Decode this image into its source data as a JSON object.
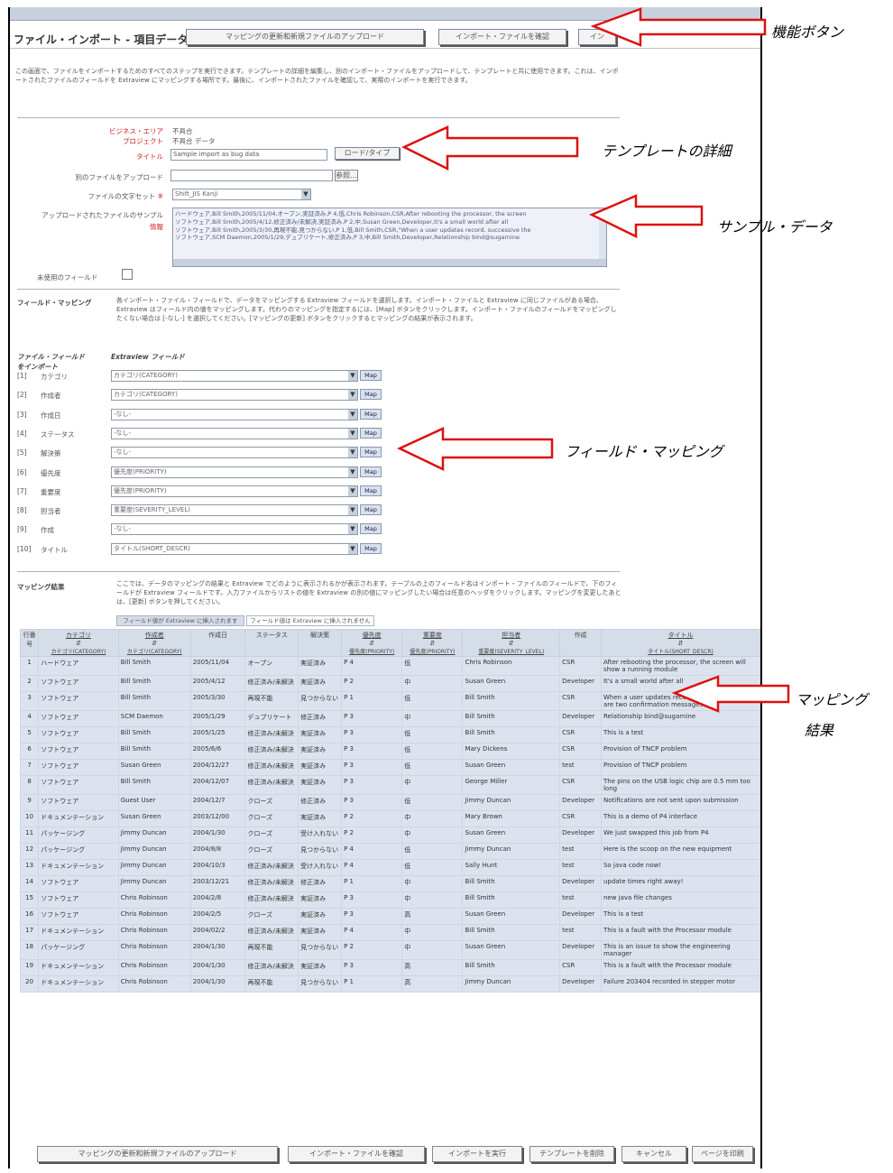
{
  "page": {
    "title": "ファイル・インポート - 項目データ",
    "intro": "この画面で、ファイルをインポートするためのすべてのステップを実行できます。テンプレートの詳細を編集し、別のインポート・ファイルをアップロードして、テンプレートと共に使用できます。これは、インポートされたファイルのフィールドを Extraview にマッピングする場所です。最後に、インポートされたファイルを確認して、実際のインポートを実行できます。"
  },
  "top_buttons": [
    "マッピングの更新和新規ファイルのアップロード",
    "インポート・ファイルを確認",
    "イン"
  ],
  "details": {
    "bizarea_label": "ビジネス・エリア",
    "bizarea_value": "不具合",
    "project_label": "プロジェクト",
    "project_value": "不具合 データ",
    "title_label": "タイトル",
    "title_value": "Sample import as bug data",
    "title_button": "ロード/タイプ",
    "upload_label": "別のファイルをアップロード",
    "upload_button": "参照...",
    "charset_label": "ファイルの文字セット",
    "charset_value": "Shift_JIS Kanji",
    "sample_label": "アップロードされたファイルのサンプル",
    "sample_sub": "情報",
    "sample_lines": [
      "ハードウェア,Bill Smith,2005/11/04,オープン,実証済み,P 4,低,Chris Robinson,CSR,After rebooting the processor, the screen",
      "ソフトウェア,Bill Smith,2005/4/12,修正済み/未解決,実証済み,P 2,中,Susan Green,Developer,It's a small world after all",
      "ソフトウェア,Bill Smith,2005/3/30,再現不能,見つからない,P 1,低,Bill Smith,CSR,\"When a user updates record, successive the",
      "ソフトウェア,SCM Daemon,2005/1/29,デュプリケート,修正済み,P 3,中,Bill Smith,Developer,Relationship bind@sugarnine"
    ],
    "unused_label": "未使用のフィールド"
  },
  "field_mapping": {
    "label": "フィールド・マッピング",
    "desc": "各インポート・ファイル・フィールドで、データをマッピングする Extraview フィールドを選択します。インポート・ファイルと Extraview に同じファイルがある場合、Extraview はフィールド内の値をマッピングします。代わりのマッピングを指定するには、[Map] ボタンをクリックします。インポート・ファイルのフィールドをマッピングしたくない場合は [-なし-] を選択してください。[マッピングの更新] ボタンをクリックするとマッピングの結果が表示されます。",
    "col_import": "ファイル・フィールドをインポート",
    "col_ev": "Extraview フィールド",
    "map_label": "Map",
    "rows": [
      {
        "no": "[1]",
        "name": "カテゴリ",
        "ev": "カテゴリ(CATEGORY)"
      },
      {
        "no": "[2]",
        "name": "作成者",
        "ev": "カテゴリ(CATEGORY)"
      },
      {
        "no": "[3]",
        "name": "作成日",
        "ev": "-なし-"
      },
      {
        "no": "[4]",
        "name": "ステータス",
        "ev": "-なし-"
      },
      {
        "no": "[5]",
        "name": "解決策",
        "ev": "-なし-"
      },
      {
        "no": "[6]",
        "name": "優先度",
        "ev": "優先度(PRIORITY)"
      },
      {
        "no": "[7]",
        "name": "重要度",
        "ev": "優先度(PRIORITY)"
      },
      {
        "no": "[8]",
        "name": "担当者",
        "ev": "重要度(SEVERITY_LEVEL)"
      },
      {
        "no": "[9]",
        "name": "作成",
        "ev": "-なし-"
      },
      {
        "no": "[10]",
        "name": "タイトル",
        "ev": "タイトル(SHORT_DESCR)"
      }
    ]
  },
  "mapping_results": {
    "label": "マッピング結果",
    "desc": "ここでは、データのマッピングの結果と Extraview でどのように表示されるかが表示されます。テーブルの上のフィールド名はインポート・ファイルのフィールドで、下のフィールドが Extraview フィールドです。入力ファイルからリストの値を Extraview の別の値にマッピングしたい場合は任意のヘッダをクリックします。マッピングを変更したあとは、[更新] ボタンを押してください。",
    "legend_a": "フィールド値が Extraview に挿入されます",
    "legend_b": "フィールド値は Extraview に挿入されません",
    "headers": [
      {
        "top": "行番号",
        "bottom": ""
      },
      {
        "top": "カテゴリ",
        "bottom": "カテゴリ(CATEGORY)"
      },
      {
        "top": "作成者",
        "bottom": "カテゴリ(CATEGORY)"
      },
      {
        "top": "作成日",
        "bottom": ""
      },
      {
        "top": "ステータス",
        "bottom": ""
      },
      {
        "top": "解決策",
        "bottom": ""
      },
      {
        "top": "優先度",
        "bottom": "優先度(PRIORITY)"
      },
      {
        "top": "重要度",
        "bottom": "優先度(PRIORITY)"
      },
      {
        "top": "担当者",
        "bottom": "重要度(SEVERITY_LEVEL)"
      },
      {
        "top": "作成",
        "bottom": ""
      },
      {
        "top": "タイトル",
        "bottom": "タイトル(SHORT_DESCR)"
      }
    ],
    "rows": [
      [
        "1",
        "ハードウェア",
        "Bill Smith",
        "2005/11/04",
        "オープン",
        "実証済み",
        "P 4",
        "低",
        "Chris Robinson",
        "CSR",
        "After rebooting the processor, the screen will show a running module"
      ],
      [
        "2",
        "ソフトウェア",
        "Bill Smith",
        "2005/4/12",
        "修正済み/未解決",
        "実証済み",
        "P 2",
        "中",
        "Susan Green",
        "Developer",
        "It's a small world after all"
      ],
      [
        "3",
        "ソフトウェア",
        "Bill Smith",
        "2005/3/30",
        "再現不能",
        "見つからない",
        "P 1",
        "低",
        "Bill Smith",
        "CSR",
        "When a user updates record, successive there are two confirmation messages"
      ],
      [
        "4",
        "ソフトウェア",
        "SCM Daemon",
        "2005/1/29",
        "デュプリケート",
        "修正済み",
        "P 3",
        "中",
        "Bill Smith",
        "Developer",
        "Relationship bind@sugarnine"
      ],
      [
        "5",
        "ソフトウェア",
        "Bill Smith",
        "2005/1/25",
        "修正済み/未解決",
        "実証済み",
        "P 3",
        "低",
        "Bill Smith",
        "CSR",
        "This is a test"
      ],
      [
        "6",
        "ソフトウェア",
        "Bill Smith",
        "2005/6/6",
        "修正済み/未解決",
        "実証済み",
        "P 3",
        "低",
        "Mary Dickens",
        "CSR",
        "Provision of TNCP problem"
      ],
      [
        "7",
        "ソフトウェア",
        "Susan Green",
        "2004/12/27",
        "修正済み/未解決",
        "実証済み",
        "P 3",
        "低",
        "Susan Green",
        "test",
        "Provision of TNCP problem"
      ],
      [
        "8",
        "ソフトウェア",
        "Bill Smith",
        "2004/12/07",
        "修正済み/未解決",
        "実証済み",
        "P 3",
        "中",
        "George Miller",
        "CSR",
        "The pins on the USB logic chip are 0.5 mm too long"
      ],
      [
        "9",
        "ソフトウェア",
        "Guest User",
        "2004/12/7",
        "クローズ",
        "修正済み",
        "P 3",
        "低",
        "Jimmy Duncan",
        "Developer",
        "Notifications are not sent upon submission"
      ],
      [
        "10",
        "ドキュメンテーション",
        "Susan Green",
        "2003/12/00",
        "クローズ",
        "実証済み",
        "P 2",
        "中",
        "Mary Brown",
        "CSR",
        "This is a demo of P4 interface"
      ],
      [
        "11",
        "パッケージング",
        "Jimmy Duncan",
        "2004/1/30",
        "クローズ",
        "受け入れない",
        "P 2",
        "中",
        "Susan Green",
        "Developer",
        "We just swapped this job from P4"
      ],
      [
        "12",
        "パッケージング",
        "Jimmy Duncan",
        "2004/8/8",
        "クローズ",
        "見つからない",
        "P 4",
        "低",
        "Jimmy Duncan",
        "test",
        "Here is the scoop on the new equipment"
      ],
      [
        "13",
        "ドキュメンテーション",
        "Jimmy Duncan",
        "2004/10/3",
        "修正済み/未解決",
        "受け入れない",
        "P 4",
        "低",
        "Sally Hunt",
        "test",
        "So java code now!"
      ],
      [
        "14",
        "ソフトウェア",
        "Jimmy Duncan",
        "2003/12/21",
        "修正済み/未解決",
        "修正済み",
        "P 1",
        "中",
        "Bill Smith",
        "Developer",
        "update times right away!"
      ],
      [
        "15",
        "ソフトウェア",
        "Chris Robinson",
        "2004/2/8",
        "修正済み/未解決",
        "実証済み",
        "P 3",
        "中",
        "Bill Smith",
        "test",
        "new java file changes"
      ],
      [
        "16",
        "ソフトウェア",
        "Chris Robinson",
        "2004/2/5",
        "クローズ",
        "実証済み",
        "P 3",
        "高",
        "Susan Green",
        "Developer",
        "This is a test"
      ],
      [
        "17",
        "ドキュメンテーション",
        "Chris Robinson",
        "2004/02/2",
        "修正済み/未解決",
        "実証済み",
        "P 4",
        "中",
        "Bill Smith",
        "test",
        "This is a fault with the Processor module"
      ],
      [
        "18",
        "パッケージング",
        "Chris Robinson",
        "2004/1/30",
        "再現不能",
        "見つからない",
        "P 2",
        "中",
        "Susan Green",
        "Developer",
        "This is an issue to show the engineering manager"
      ],
      [
        "19",
        "ドキュメンテーション",
        "Chris Robinson",
        "2004/1/30",
        "修正済み/未解決",
        "実証済み",
        "P 3",
        "高",
        "Bill Smith",
        "CSR",
        "This is a fault with the Processor module"
      ],
      [
        "20",
        "ドキュメンテーション",
        "Chris Robinson",
        "2004/1/30",
        "再現不能",
        "見つからない",
        "P 1",
        "高",
        "Jimmy Duncan",
        "Developer",
        "Failure 203404 recorded in stepper motor"
      ]
    ]
  },
  "bottom_buttons": [
    "マッピングの更新和新規ファイルのアップロード",
    "インポート・ファイルを確認",
    "インポートを実行",
    "テンプレートを削除",
    "キャンセル",
    "ページを印刷"
  ],
  "annotations": {
    "function_buttons": "機能ボタン",
    "template_details": "テンプレートの詳細",
    "sample_data": "サンプル・データ",
    "field_mapping": "フィールド・マッピング",
    "mapping_results_1": "マッピング",
    "mapping_results_2": "結果"
  },
  "colors": {
    "arrow": "#dd1111",
    "table_bg": "#dce3ee",
    "header_strip": "#c7d0dd"
  }
}
